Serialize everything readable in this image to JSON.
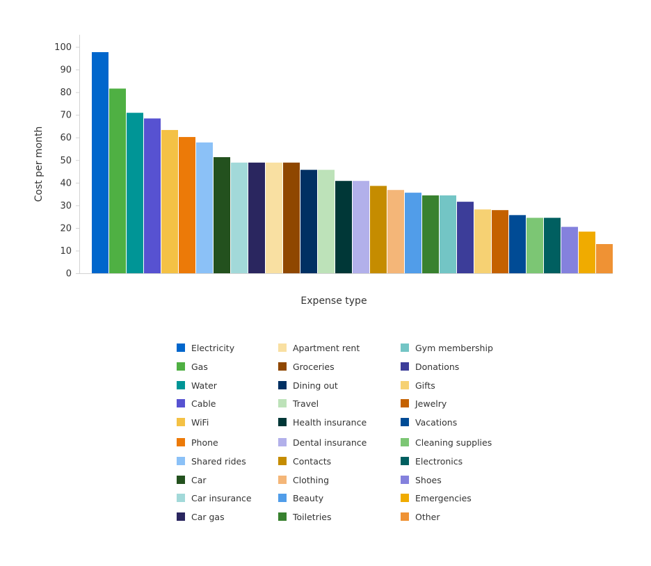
{
  "chart_data": {
    "type": "bar",
    "title": "",
    "xlabel": "Expense type",
    "ylabel": "Cost per month",
    "ylim": [
      0,
      100
    ],
    "yticks": [
      0,
      10,
      20,
      30,
      40,
      50,
      60,
      70,
      80,
      90,
      100
    ],
    "grid": false,
    "legend_position": "bottom",
    "categories": [
      "Electricity",
      "Gas",
      "Water",
      "Cable",
      "WiFi",
      "Phone",
      "Shared rides",
      "Car",
      "Car insurance",
      "Car gas",
      "Apartment rent",
      "Groceries",
      "Dining out",
      "Travel",
      "Health insurance",
      "Dental insurance",
      "Contacts",
      "Clothing",
      "Beauty",
      "Toiletries",
      "Gym membership",
      "Donations",
      "Gifts",
      "Jewelry",
      "Vacations",
      "Cleaning supplies",
      "Electronics",
      "Shoes",
      "Emergencies",
      "Other"
    ],
    "values": [
      97.7,
      81.6,
      70.9,
      68.4,
      63.3,
      60.2,
      57.8,
      51.3,
      48.9,
      48.9,
      48.9,
      48.9,
      45.7,
      45.7,
      40.8,
      40.8,
      38.6,
      36.8,
      35.6,
      34.4,
      34.4,
      31.6,
      28.2,
      27.9,
      25.7,
      24.5,
      24.5,
      20.5,
      18.4,
      12.9
    ],
    "colors": [
      "#0066cc",
      "#4fb043",
      "#009596",
      "#5752d1",
      "#f4c145",
      "#ec7a08",
      "#8bc1f7",
      "#23511e",
      "#a2d9d9",
      "#2a265f",
      "#f9e0a2",
      "#8f4700",
      "#003063",
      "#bde2b9",
      "#003737",
      "#b2b0ea",
      "#c58c00",
      "#f4b678",
      "#519de9",
      "#38812f",
      "#73c5c5",
      "#3c3d99",
      "#f6d173",
      "#c46100",
      "#004b95",
      "#7cc674",
      "#005f60",
      "#8481dd",
      "#f0ab00",
      "#ef9234"
    ]
  }
}
